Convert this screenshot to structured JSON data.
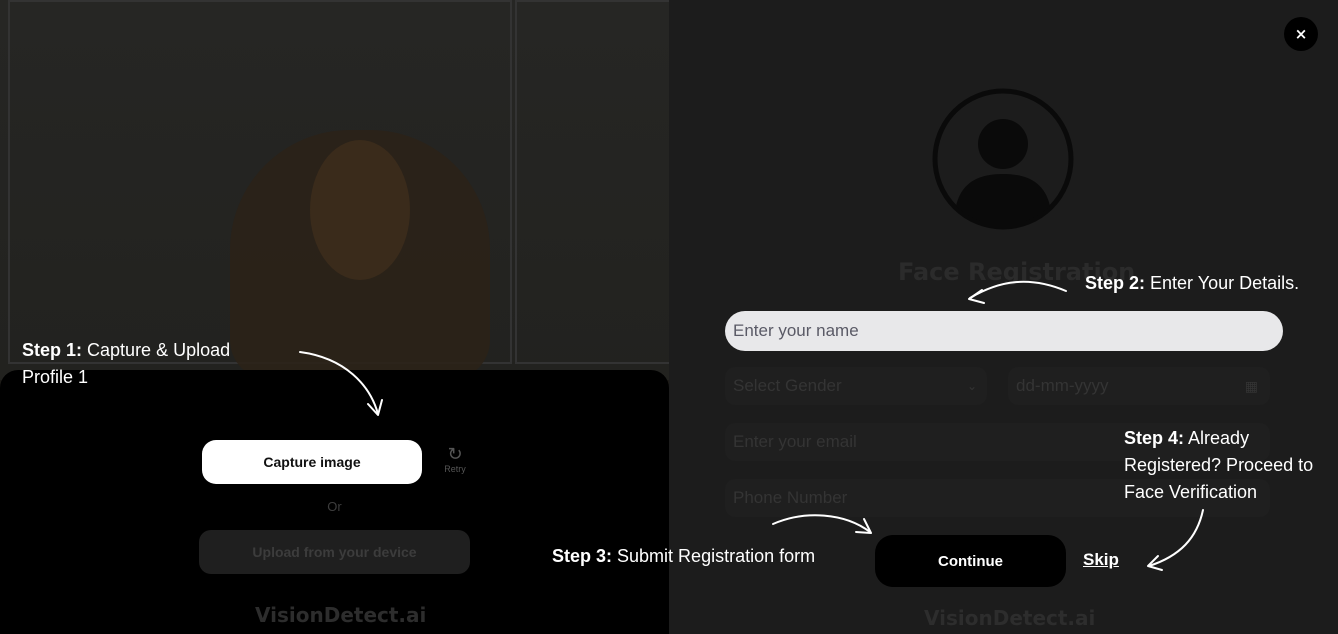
{
  "camera": {
    "capture_label": "Capture image",
    "retry_label": "Retry",
    "or_label": "Or",
    "upload_label": "Upload from your device",
    "brand": "VisionDetect.ai"
  },
  "form": {
    "close_symbol": "×",
    "title": "Face Registration",
    "name_placeholder": "Enter your name",
    "gender_placeholder": "Select Gender",
    "dob_placeholder": "dd-mm-yyyy",
    "email_placeholder": "Enter your email",
    "phone_placeholder": "Phone Number",
    "continue_label": "Continue",
    "skip_label": "Skip",
    "brand": "VisionDetect.ai"
  },
  "steps": [
    {
      "label": "Step 1:",
      "text": "Capture & Upload Profile 1"
    },
    {
      "label": "Step 2:",
      "text": "Enter Your Details."
    },
    {
      "label": "Step 3:",
      "text": "Submit Registration form"
    },
    {
      "label": "Step 4:",
      "text": "Already Registered? Proceed to Face Verification"
    }
  ],
  "icons": {
    "retry": "retry-icon",
    "avatar": "user-avatar-icon",
    "chevron": "chevron-down-icon",
    "calendar": "calendar-icon",
    "close": "close-icon"
  },
  "colors": {
    "overlay": "#1c1c1c",
    "panel": "#000000",
    "input_active": "#e8e8ea",
    "text": "#ffffff"
  }
}
